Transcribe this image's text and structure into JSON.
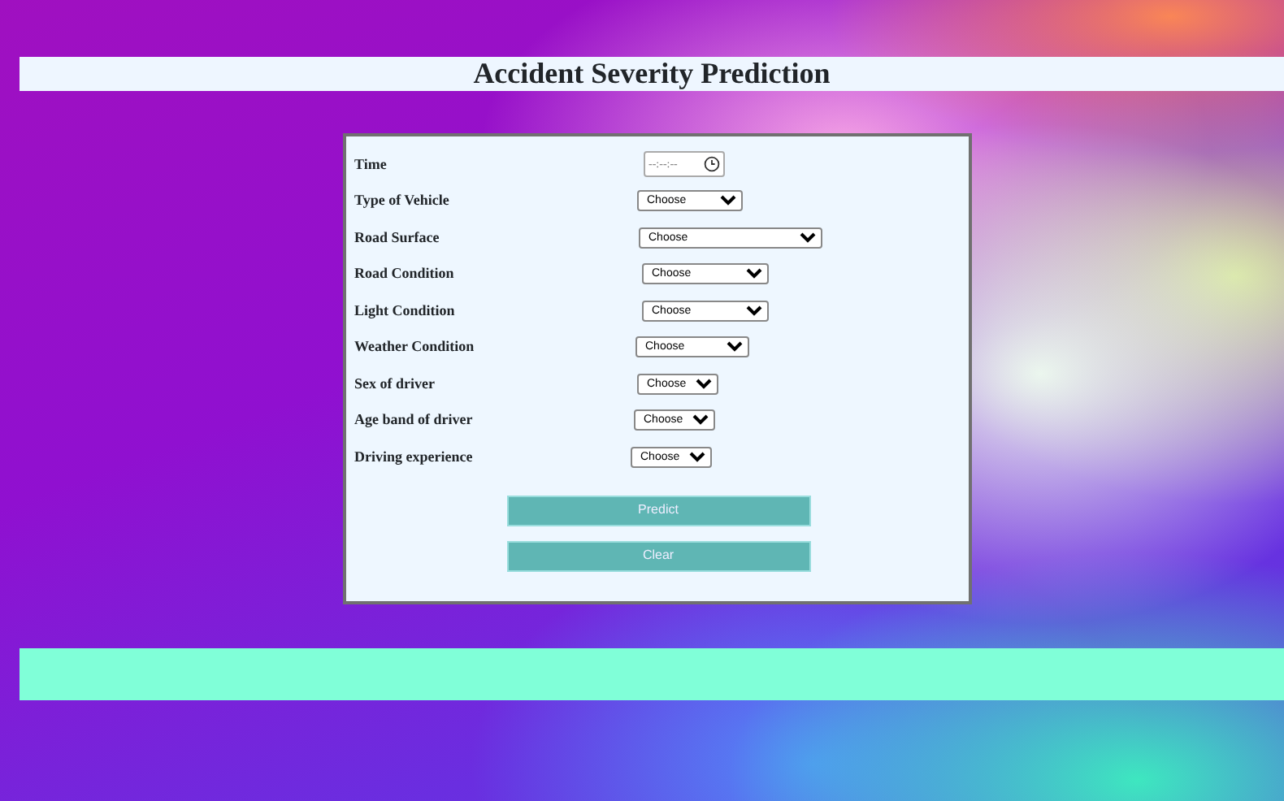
{
  "title": "Accident Severity Prediction",
  "form": {
    "time": {
      "label": "Time",
      "placeholder": "--:--:--"
    },
    "selects": [
      {
        "label": "Type of Vehicle",
        "value": "Choose"
      },
      {
        "label": "Road Surface",
        "value": "Choose"
      },
      {
        "label": "Road Condition",
        "value": "Choose"
      },
      {
        "label": "Light Condition",
        "value": "Choose"
      },
      {
        "label": "Weather Condition",
        "value": "Choose"
      },
      {
        "label": "Sex of driver",
        "value": "Choose"
      },
      {
        "label": "Age band of driver",
        "value": "Choose"
      },
      {
        "label": "Driving experience",
        "value": "Choose"
      }
    ],
    "buttons": [
      "Predict",
      "Clear"
    ]
  }
}
